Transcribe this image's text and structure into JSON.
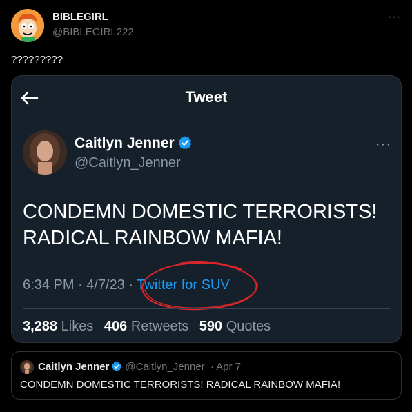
{
  "post": {
    "author_name": "BIBLEGIRL",
    "author_handle": "@BIBLEGIRL222",
    "more_label": "···",
    "text": "?????????"
  },
  "embedded_screenshot": {
    "header_title": "Tweet",
    "author_name": "Caitlyn Jenner",
    "author_handle": "@Caitlyn_Jenner",
    "more_label": "···",
    "text": "CONDEMN DOMESTIC TERRORISTS! RADICAL RAINBOW MAFIA!",
    "time": "6:34 PM",
    "date": "4/7/23",
    "source": "Twitter for SUV",
    "stats": {
      "likes_count": "3,288",
      "likes_label": "Likes",
      "retweets_count": "406",
      "retweets_label": "Retweets",
      "quotes_count": "590",
      "quotes_label": "Quotes"
    },
    "annotation_color": "#d9262b"
  },
  "quoted_tweet": {
    "author_name": "Caitlyn Jenner",
    "author_handle": "@Caitlyn_Jenner",
    "date": "· Apr 7",
    "text": "CONDEMN DOMESTIC TERRORISTS! RADICAL RAINBOW MAFIA!"
  },
  "colors": {
    "verified": "#1d9bf0",
    "link": "#1d9bf0",
    "background": "#000000",
    "card_background": "#15202b"
  }
}
